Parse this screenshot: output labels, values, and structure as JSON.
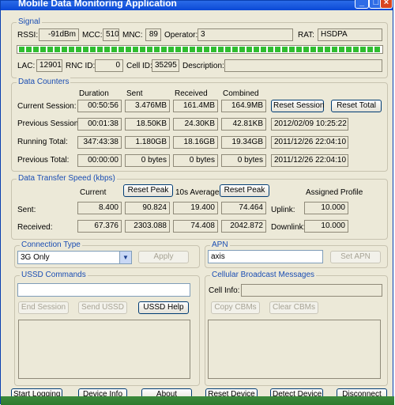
{
  "window": {
    "title": "Mobile Data Monitoring Application"
  },
  "signal": {
    "legend": "Signal",
    "rssi_label": "RSSI:",
    "rssi": "-91dBm",
    "mcc_label": "MCC:",
    "mcc": "510",
    "mnc_label": "MNC:",
    "mnc": "89",
    "operator_label": "Operator:",
    "operator": "3",
    "rat_label": "RAT:",
    "rat": "HSDPA",
    "lac_label": "LAC:",
    "lac": "12901",
    "rnc_label": "RNC ID:",
    "rnc": "0",
    "cell_label": "Cell ID:",
    "cell": "35295",
    "desc_label": "Description:",
    "desc": "",
    "signal_strength_level": 1.0
  },
  "data_counters": {
    "legend": "Data Counters",
    "headers": [
      "Duration",
      "Sent",
      "Received",
      "Combined"
    ],
    "rows": [
      {
        "label": "Current Session:",
        "duration": "00:50:56",
        "sent": "3.476MB",
        "received": "161.4MB",
        "combined": "164.9MB"
      },
      {
        "label": "Previous Session:",
        "duration": "00:01:38",
        "sent": "18.50KB",
        "received": "24.30KB",
        "combined": "42.81KB",
        "date": "2012/02/09 10:25:22"
      },
      {
        "label": "Running Total:",
        "duration": "347:43:38",
        "sent": "1.180GB",
        "received": "18.16GB",
        "combined": "19.34GB",
        "date": "2011/12/26 22:04:10"
      },
      {
        "label": "Previous Total:",
        "duration": "00:00:00",
        "sent": "0 bytes",
        "received": "0 bytes",
        "combined": "0 bytes",
        "date": "2011/12/26 22:04:10"
      }
    ],
    "reset_session": "Reset Session",
    "reset_total": "Reset Total"
  },
  "speed": {
    "legend": "Data Transfer Speed (kbps)",
    "current_label": "Current",
    "avg_label": "10s Average",
    "reset_peak": "Reset Peak",
    "assigned_label": "Assigned Profile",
    "sent_label": "Sent:",
    "received_label": "Received:",
    "sent": {
      "current": "8.400",
      "peak": "90.824",
      "avg": "19.400",
      "avg_peak": "74.464"
    },
    "received": {
      "current": "67.376",
      "peak": "2303.088",
      "avg": "74.408",
      "avg_peak": "2042.872"
    },
    "uplink_label": "Uplink:",
    "uplink": "10.000",
    "downlink_label": "Downlink:",
    "downlink": "10.000"
  },
  "connection": {
    "legend": "Connection Type",
    "value": "3G Only",
    "apply": "Apply"
  },
  "apn": {
    "legend": "APN",
    "value": "axis",
    "set": "Set APN"
  },
  "ussd": {
    "legend": "USSD Commands",
    "input": "",
    "end": "End Session",
    "send": "Send USSD",
    "help": "USSD Help"
  },
  "cbm": {
    "legend": "Cellular Broadcast Messages",
    "cell_info_label": "Cell Info:",
    "cell_info": "",
    "copy": "Copy CBMs",
    "clear": "Clear CBMs"
  },
  "bottom": {
    "start_logging": "Start Logging",
    "device_info": "Device Info",
    "about": "About",
    "reset_device": "Reset Device",
    "detect_device": "Detect Device",
    "disconnect": "Disconnect"
  }
}
